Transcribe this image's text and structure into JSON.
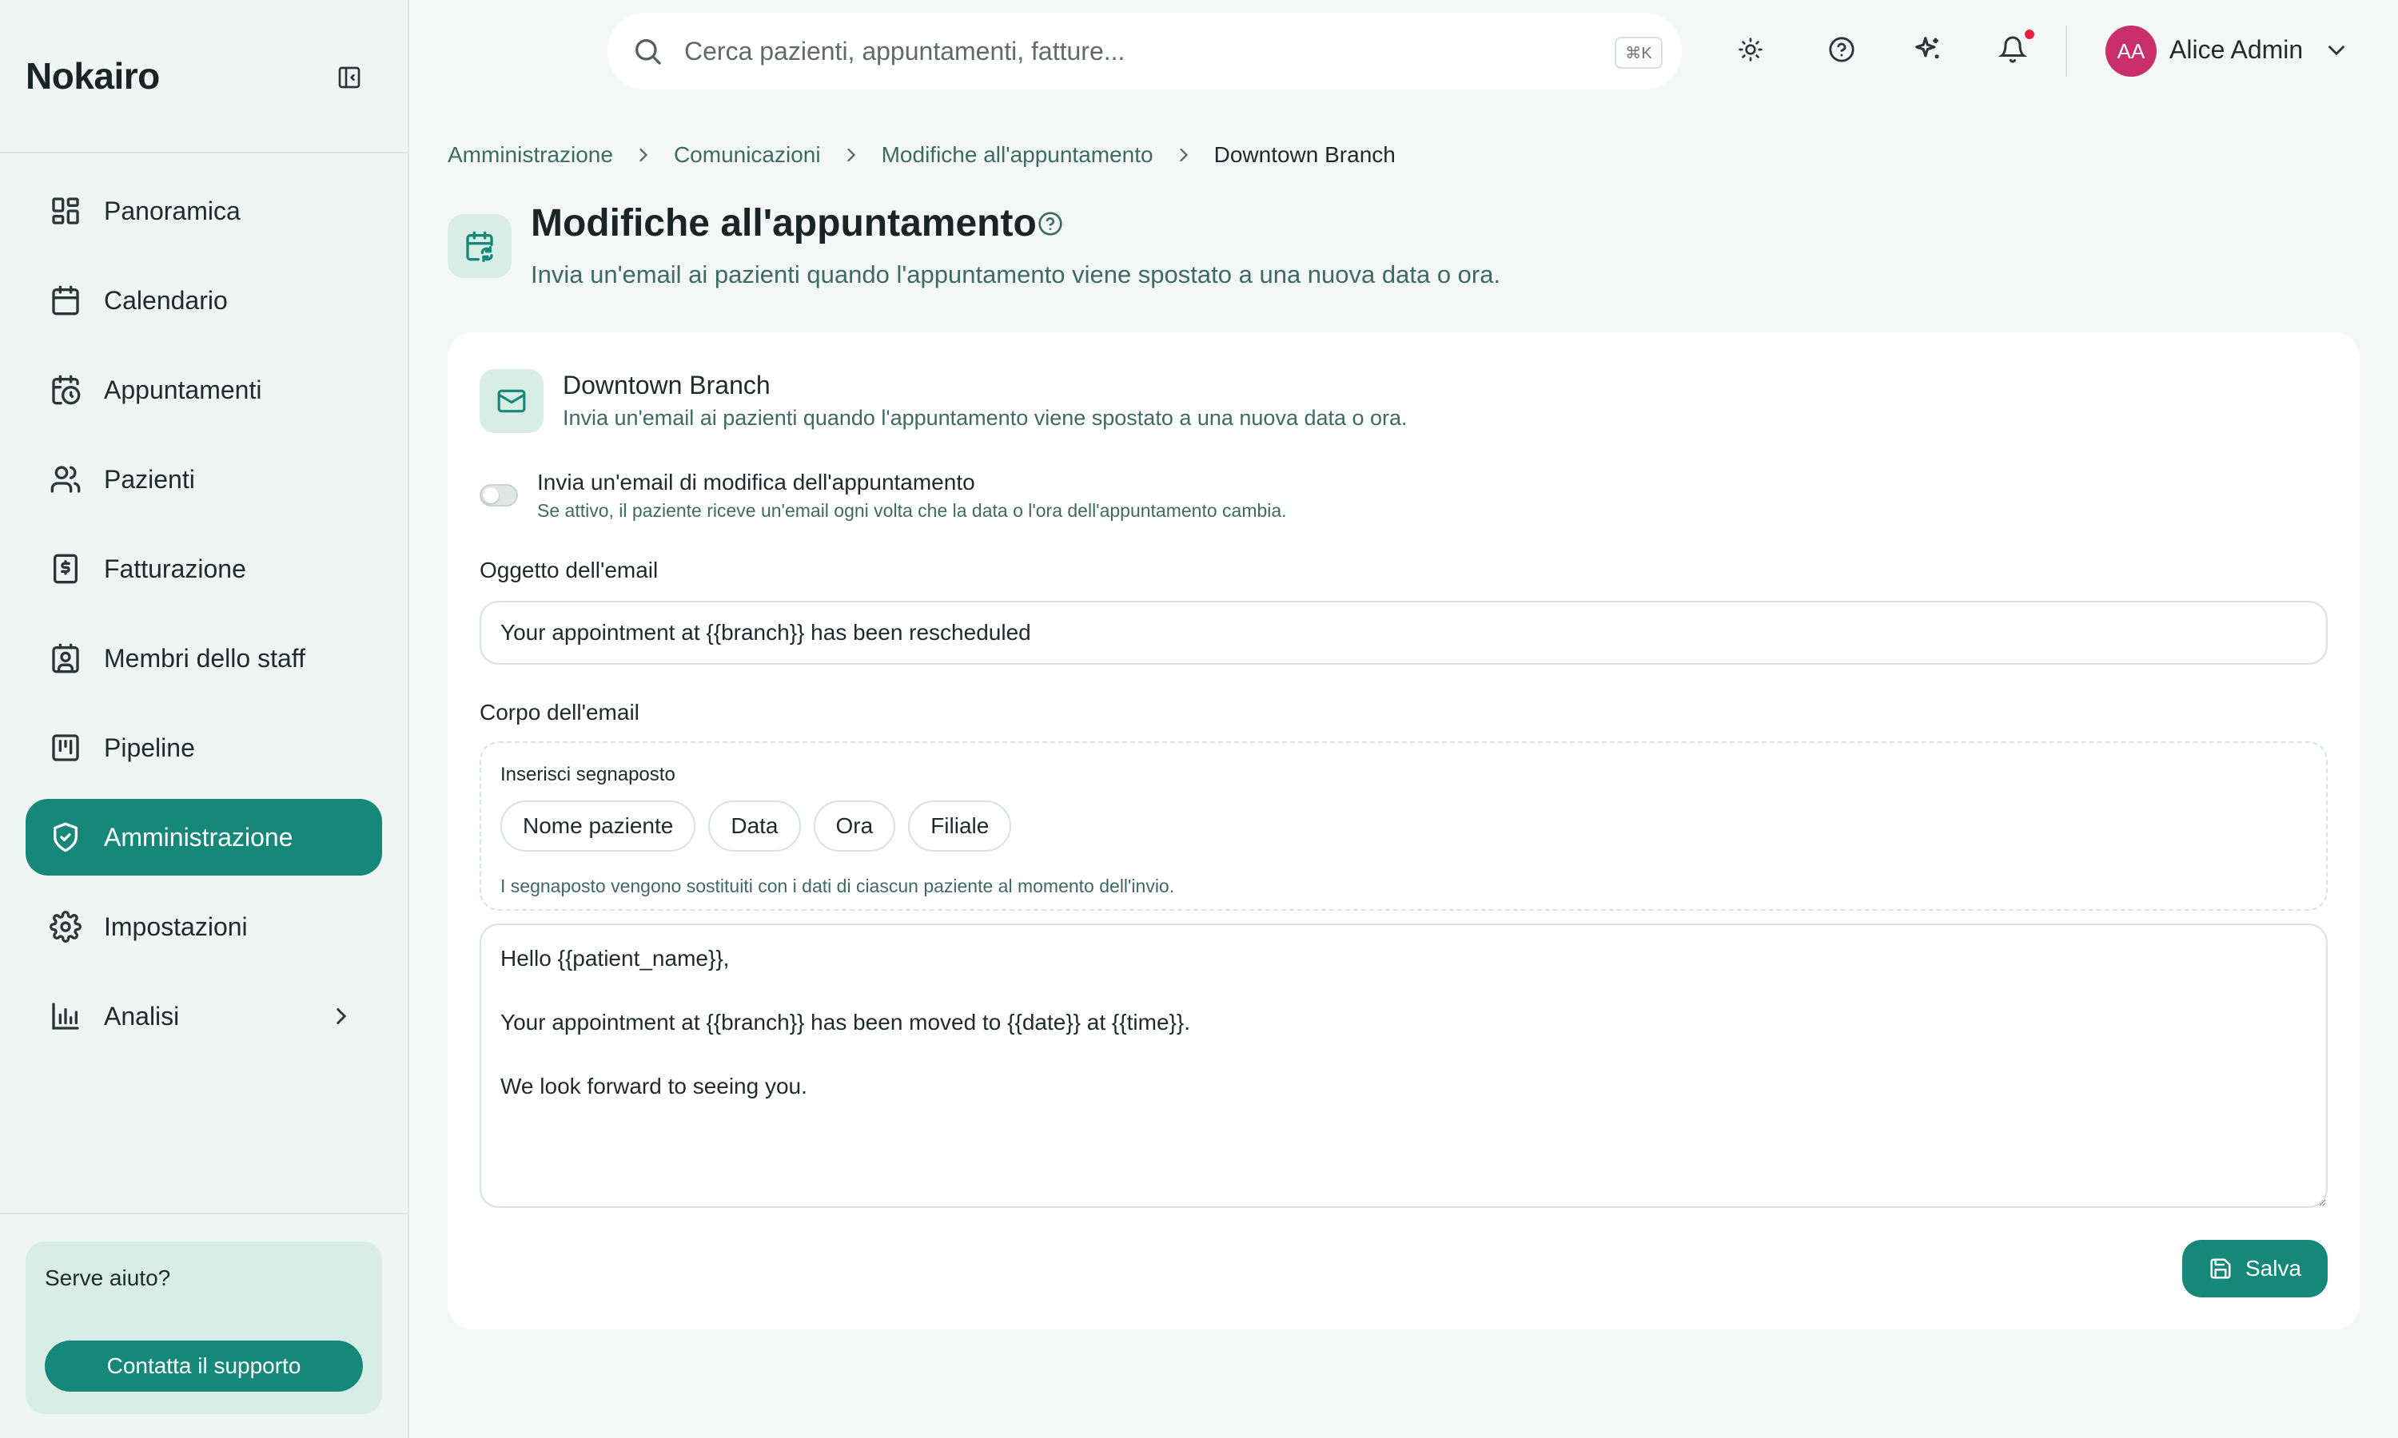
{
  "app": {
    "brand": "Nokairo"
  },
  "sidebar": {
    "items": [
      {
        "label": "Panoramica",
        "icon": "layout-dashboard-icon"
      },
      {
        "label": "Calendario",
        "icon": "calendar-icon"
      },
      {
        "label": "Appuntamenti",
        "icon": "calendar-clock-icon"
      },
      {
        "label": "Pazienti",
        "icon": "users-icon"
      },
      {
        "label": "Fatturazione",
        "icon": "receipt-dollar-icon"
      },
      {
        "label": "Membri dello staff",
        "icon": "contact-badge-icon"
      },
      {
        "label": "Pipeline",
        "icon": "kanban-icon"
      },
      {
        "label": "Amministrazione",
        "icon": "shield-check-icon",
        "active": true
      },
      {
        "label": "Impostazioni",
        "icon": "gear-icon"
      },
      {
        "label": "Analisi",
        "icon": "bar-chart-icon",
        "has_submenu": true
      }
    ],
    "help": {
      "title": "Serve aiuto?",
      "button": "Contatta il supporto"
    }
  },
  "topbar": {
    "search_placeholder": "Cerca pazienti, appuntamenti, fatture...",
    "shortcut": "⌘K",
    "user": {
      "initials": "AA",
      "name": "Alice Admin"
    },
    "has_notification": true
  },
  "breadcrumb": [
    "Amministrazione",
    "Comunicazioni",
    "Modifiche all'appuntamento",
    "Downtown Branch"
  ],
  "page": {
    "title": "Modifiche all'appuntamento",
    "subtitle": "Invia un'email ai pazienti quando l'appuntamento viene spostato a una nuova data o ora."
  },
  "card": {
    "title": "Downtown Branch",
    "description": "Invia un'email ai pazienti quando l'appuntamento viene spostato a una nuova data o ora.",
    "toggle": {
      "label": "Invia un'email di modifica dell'appuntamento",
      "help": "Se attivo, il paziente riceve un'email ogni volta che la data o l'ora dell'appuntamento cambia.",
      "enabled": false
    },
    "subject": {
      "label": "Oggetto dell'email",
      "value": "Your appointment at {{branch}} has been rescheduled"
    },
    "body": {
      "label": "Corpo dell'email",
      "placeholder_title": "Inserisci segnaposto",
      "chips": [
        "Nome paziente",
        "Data",
        "Ora",
        "Filiale"
      ],
      "placeholder_hint": "I segnaposto vengono sostituiti con i dati di ciascun paziente al momento dell'invio.",
      "value": "Hello {{patient_name}},\n\nYour appointment at {{branch}} has been moved to {{date}} at {{time}}.\n\nWe look forward to seeing you."
    },
    "save_label": "Salva"
  },
  "colors": {
    "accent": "#16887a",
    "accent_soft": "#d9ede7",
    "background": "#f3f8f6",
    "notification": "#e0223f",
    "avatar": "#c9306a"
  }
}
